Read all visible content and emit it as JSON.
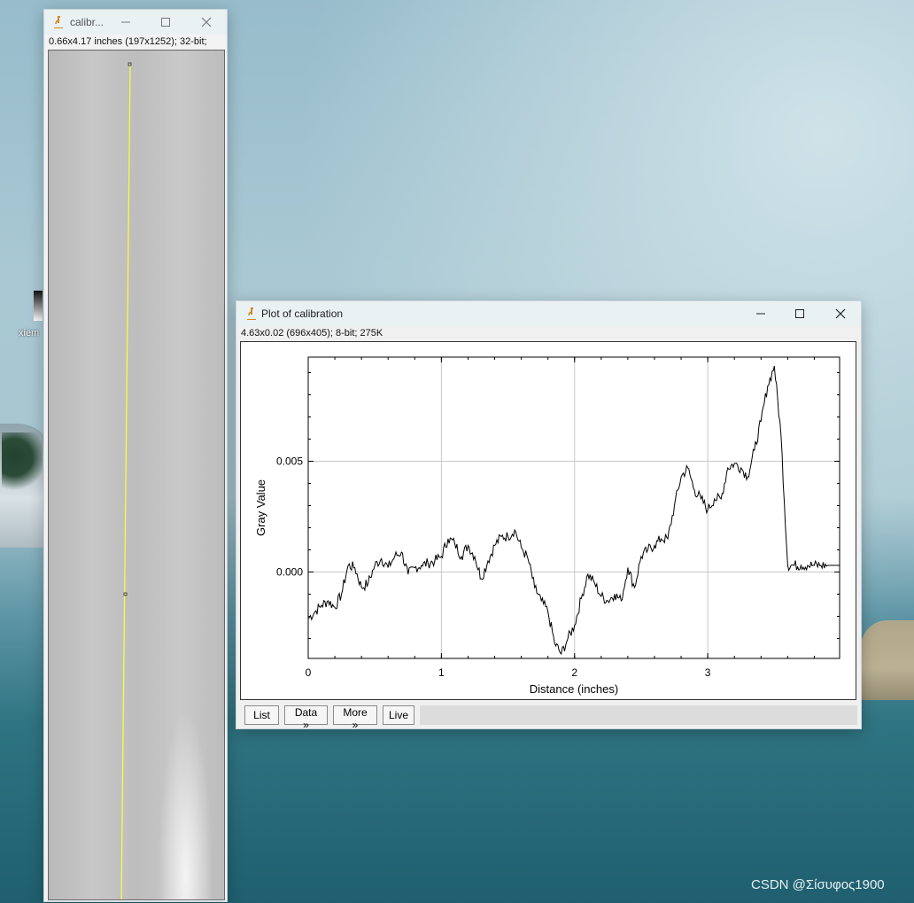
{
  "desktop": {
    "icon_label": "xiem",
    "watermark": "CSDN @Σίσυφος1900"
  },
  "image_window": {
    "title": "calibr...",
    "info": "0.66x4.17 inches (197x1252); 32-bit;"
  },
  "plot_window": {
    "title": "Plot of calibration",
    "info": "4.63x0.02  (696x405); 8-bit; 275K",
    "buttons": {
      "list": "List",
      "data": "Data »",
      "more": "More »",
      "live": "Live"
    }
  },
  "colors": {
    "selection_line": "#ffff33",
    "plot_line": "#000000",
    "grid": "#c8c8c8"
  },
  "chart_data": {
    "type": "line",
    "xlabel": "Distance (inches)",
    "ylabel": "Gray Value",
    "xlim": [
      0,
      3.99
    ],
    "ylim": [
      -0.0039,
      0.0097
    ],
    "x_ticks": [
      0,
      1,
      2,
      3
    ],
    "x_tick_labels": [
      "0",
      "1",
      "2",
      "3"
    ],
    "y_ticks": [
      0.0,
      0.005
    ],
    "y_tick_labels": [
      "0.000",
      "0.005"
    ],
    "grid": true,
    "series": [
      {
        "x": [
          0.0,
          0.05,
          0.1,
          0.15,
          0.2,
          0.25,
          0.3,
          0.35,
          0.4,
          0.45,
          0.5,
          0.55,
          0.6,
          0.65,
          0.7,
          0.75,
          0.8,
          0.85,
          0.9,
          0.95,
          1.0,
          1.05,
          1.1,
          1.15,
          1.2,
          1.25,
          1.3,
          1.35,
          1.4,
          1.45,
          1.5,
          1.55,
          1.6,
          1.65,
          1.7,
          1.75,
          1.8,
          1.85,
          1.9,
          1.95,
          2.0,
          2.05,
          2.1,
          2.15,
          2.2,
          2.25,
          2.3,
          2.35,
          2.4,
          2.45,
          2.5,
          2.55,
          2.6,
          2.65,
          2.7,
          2.75,
          2.8,
          2.85,
          2.9,
          2.95,
          3.0,
          3.05,
          3.1,
          3.15,
          3.2,
          3.25,
          3.3,
          3.35,
          3.4,
          3.45,
          3.5,
          3.55,
          3.6,
          3.65,
          3.7,
          3.75,
          3.8,
          3.85,
          3.9,
          3.94,
          3.97,
          3.99
        ],
        "y": [
          -0.0021,
          -0.0018,
          -0.0015,
          -0.0013,
          -0.0016,
          -0.001,
          0.0003,
          0.0002,
          -0.0007,
          -0.0005,
          0.0003,
          0.0006,
          0.0002,
          0.0007,
          0.0009,
          -0.0001,
          0.0002,
          0.0003,
          0.0004,
          0.0005,
          0.0007,
          0.0015,
          0.0013,
          0.0007,
          0.0012,
          0.0007,
          -0.0003,
          0.0005,
          0.0012,
          0.0016,
          0.0016,
          0.0019,
          0.0011,
          0.0006,
          -0.0007,
          -0.0013,
          -0.0018,
          -0.0032,
          -0.0037,
          -0.003,
          -0.0024,
          -0.0012,
          -0.0001,
          -0.0005,
          -0.0011,
          -0.0013,
          -0.001,
          -0.0013,
          0.0002,
          -0.0007,
          0.0007,
          0.001,
          0.0012,
          0.0015,
          0.0015,
          0.003,
          0.0043,
          0.0047,
          0.0037,
          0.0033,
          0.0028,
          0.0033,
          0.0033,
          0.0047,
          0.0049,
          0.0047,
          0.0043,
          0.0055,
          0.0068,
          0.0084,
          0.0093,
          0.0062,
          0.0003,
          0.0003,
          0.0003,
          0.0003,
          0.0003,
          0.0003,
          0.0003,
          0.0003,
          0.0003,
          0.0003
        ]
      }
    ]
  }
}
